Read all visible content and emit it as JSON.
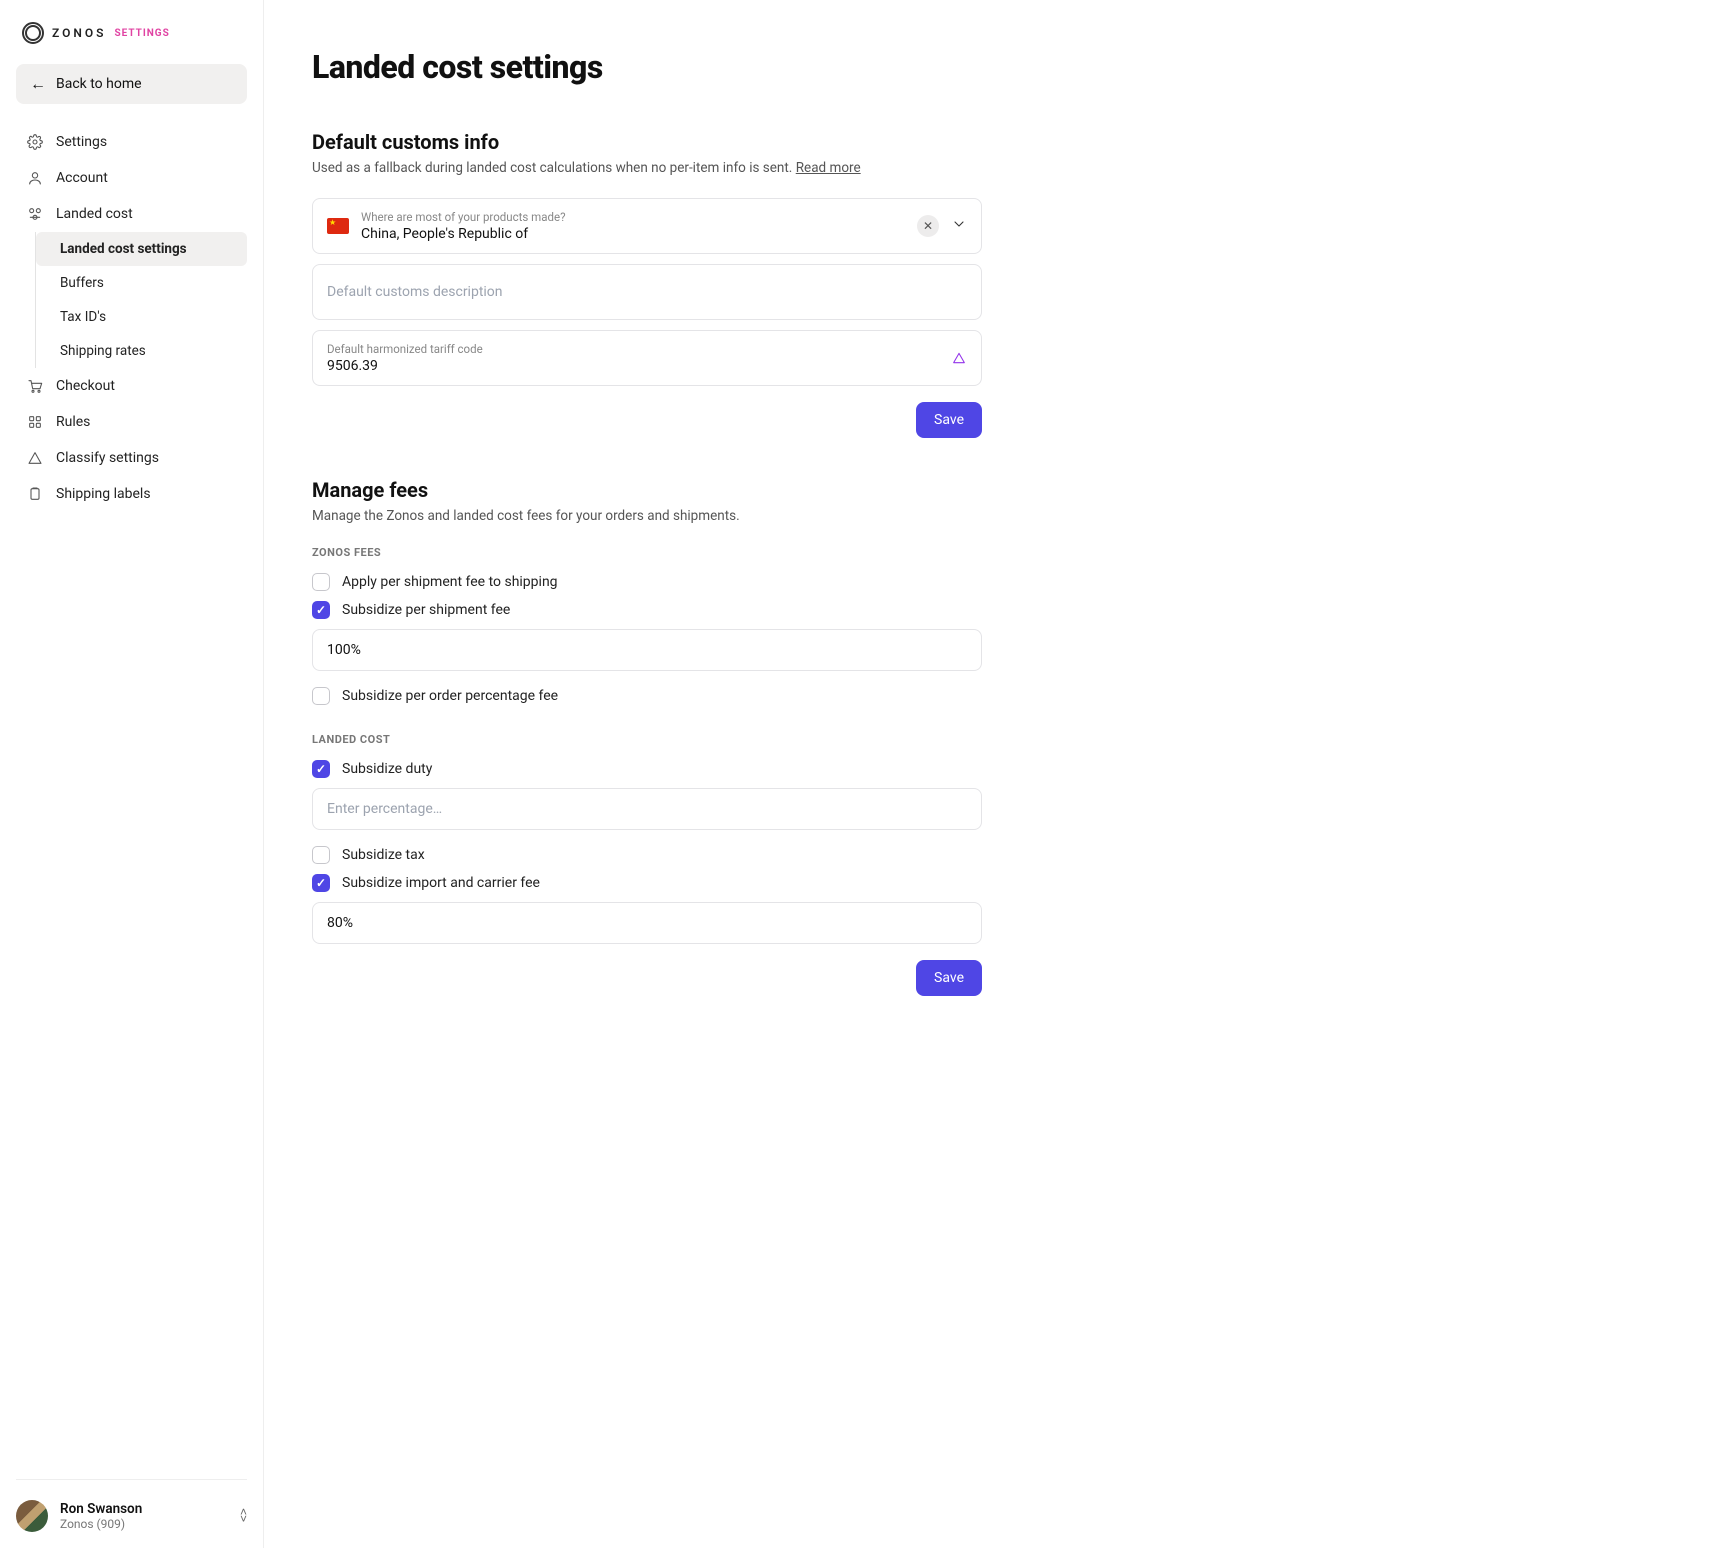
{
  "brand": {
    "word": "ZONOS",
    "label": "SETTINGS"
  },
  "back_home": "Back to home",
  "sidebar": {
    "items": [
      {
        "label": "Settings"
      },
      {
        "label": "Account"
      },
      {
        "label": "Landed cost"
      },
      {
        "label": "Checkout"
      },
      {
        "label": "Rules"
      },
      {
        "label": "Classify settings"
      },
      {
        "label": "Shipping labels"
      }
    ],
    "landed_cost_sub": [
      "Landed cost settings",
      "Buffers",
      "Tax ID's",
      "Shipping rates"
    ]
  },
  "user": {
    "name": "Ron Swanson",
    "org": "Zonos (909)"
  },
  "page": {
    "title": "Landed cost settings",
    "customs": {
      "heading": "Default customs info",
      "desc": "Used as a fallback during landed cost calculations when no per-item info is sent. ",
      "read_more": "Read more",
      "origin_label": "Where are most of your products made?",
      "origin_value": "China, People's Republic of",
      "description_placeholder": "Default customs description",
      "hts_label": "Default harmonized tariff code",
      "hts_value": "9506.39",
      "save": "Save"
    },
    "fees": {
      "heading": "Manage fees",
      "desc": "Manage the Zonos and landed cost fees for your orders and shipments.",
      "zonos_eyebrow": "ZONOS FEES",
      "apply_per_shipment": "Apply per shipment fee to shipping",
      "subsidize_per_shipment": "Subsidize per shipment fee",
      "subsidize_per_shipment_value": "100%",
      "subsidize_per_order_pct": "Subsidize per order percentage fee",
      "landed_eyebrow": "LANDED COST",
      "subsidize_duty": "Subsidize duty",
      "duty_placeholder": "Enter percentage…",
      "subsidize_tax": "Subsidize tax",
      "subsidize_import_carrier": "Subsidize import and carrier fee",
      "import_carrier_value": "80%",
      "save": "Save"
    }
  }
}
